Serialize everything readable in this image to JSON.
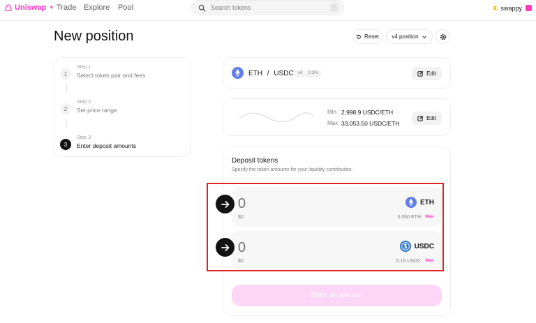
{
  "nav": {
    "brand": "Uniswap",
    "links": [
      "Trade",
      "Explore",
      "Pool"
    ],
    "search_placeholder": "Search tokens",
    "search_shortcut": "/",
    "user": "swappy"
  },
  "header": {
    "title": "New position",
    "reset_label": "Reset",
    "version_label": "v4 position"
  },
  "steps": [
    {
      "sub": "Step 1",
      "label": "Select token pair and fees",
      "num": "1",
      "active": false
    },
    {
      "sub": "Step 2",
      "label": "Set price range",
      "num": "2",
      "active": false
    },
    {
      "sub": "Step 3",
      "label": "Enter deposit amounts",
      "num": "3",
      "active": true
    }
  ],
  "pair": {
    "token0": "ETH",
    "separator": "/",
    "token1": "USDC",
    "version_badge": "v4",
    "fee_badge": "0.3%",
    "edit_label": "Edit"
  },
  "range": {
    "min_label": "Min",
    "min_value": "2,998.9 USDC/ETH",
    "max_label": "Max",
    "max_value": "33,053.50 USDC/ETH",
    "edit_label": "Edit"
  },
  "deposit": {
    "title": "Deposit tokens",
    "description": "Specify the token amounts for your liquidity contribution.",
    "inputs": [
      {
        "amount_placeholder": "0",
        "usd": "$0",
        "token": "ETH",
        "balance": "0.060 ETH",
        "max_label": "Max"
      },
      {
        "amount_placeholder": "0",
        "usd": "$0",
        "token": "USDC",
        "balance": "5.15 USDC",
        "max_label": "Max"
      }
    ],
    "cta_label": "Enter an amount"
  },
  "colors": {
    "accent": "#ff37c7",
    "eth_icon": "#627eea",
    "usdc_icon": "#2775ca",
    "highlight": "#e02424"
  }
}
